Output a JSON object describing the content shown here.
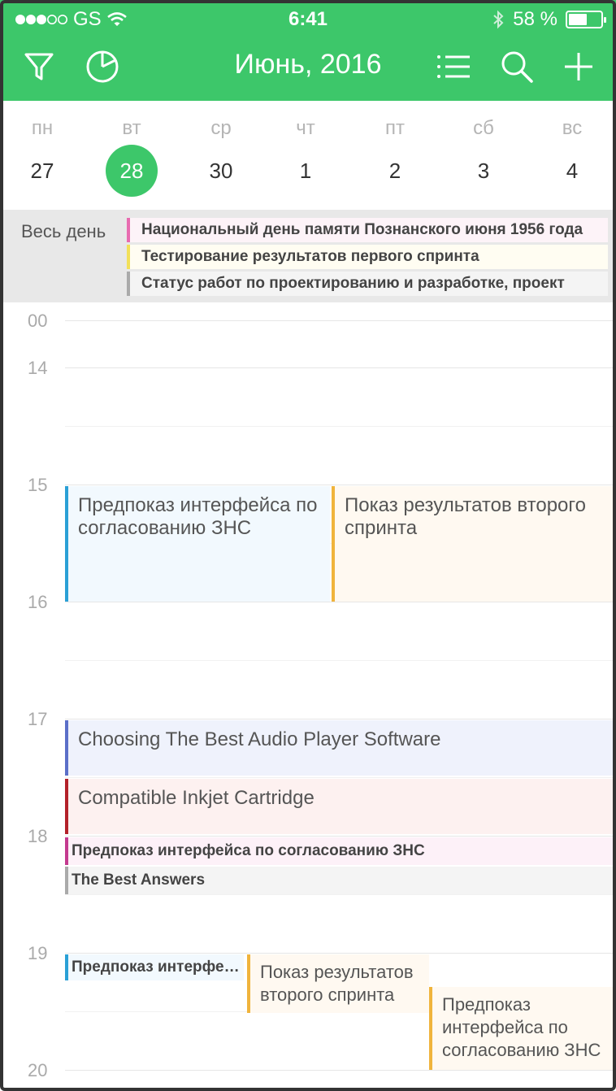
{
  "status_bar": {
    "carrier": "GS",
    "time": "6:41",
    "battery": "58 %",
    "battery_level": 0.58
  },
  "toolbar": {
    "title": "Июнь, 2016",
    "icons": [
      "filter-icon",
      "pie-chart-icon",
      "list-icon",
      "search-icon",
      "plus-icon"
    ]
  },
  "colors": {
    "brand_green": "#3dc76a"
  },
  "week": {
    "days": [
      {
        "dow": "пн",
        "num": "27"
      },
      {
        "dow": "вт",
        "num": "28",
        "selected": true
      },
      {
        "dow": "ср",
        "num": "30"
      },
      {
        "dow": "чт",
        "num": "1"
      },
      {
        "dow": "пт",
        "num": "2"
      },
      {
        "dow": "сб",
        "num": "3"
      },
      {
        "dow": "вс",
        "num": "4"
      }
    ]
  },
  "all_day": {
    "label": "Весь день",
    "events": [
      {
        "title": "Национальный день памяти Познанского июня 1956 года",
        "color": "#e86bb0",
        "bg": "#fdf3f8"
      },
      {
        "title": "Тестирование результатов первого спринта",
        "color": "#f2e05a",
        "bg": "#fffdf2"
      },
      {
        "title": "Статус работ по проектированию и разработке, проект",
        "color": "#aaaaaa",
        "bg": "#f4f4f4"
      }
    ]
  },
  "hours": [
    "00",
    "14",
    "15",
    "16",
    "17",
    "18",
    "19",
    "20"
  ],
  "events": [
    {
      "title": "Предпоказ интерфейса по согласованию ЗНС",
      "color": "#2aa0d6",
      "bg": "#f2f9fe"
    },
    {
      "title": "Показ результатов второго спринта",
      "color": "#f0b43c",
      "bg": "#fff9f1"
    },
    {
      "title": "Choosing The Best Audio Player Software",
      "color": "#5b6fc8",
      "bg": "#eff2fc"
    },
    {
      "title": "Compatible Inkjet Cartridge",
      "color": "#b3222a",
      "bg": "#fdf1f0"
    },
    {
      "title": "Предпоказ интерфейса по согласованию ЗНС",
      "color": "#c43a8f",
      "bg": "#fdf1f8"
    },
    {
      "title": "The Best Answers",
      "color": "#aaaaaa",
      "bg": "#f4f4f4"
    },
    {
      "title": "Предпоказ интерфейса по согласованию ЗНС",
      "color": "#2aa0d6",
      "bg": "#f2f9fe"
    },
    {
      "title": "Показ результатов второго спринта",
      "color": "#f0b43c",
      "bg": "#fff9f1"
    },
    {
      "title": "Предпоказ интерфейса по согласованию ЗНС",
      "color": "#f0b43c",
      "bg": "#fff9f1"
    }
  ]
}
